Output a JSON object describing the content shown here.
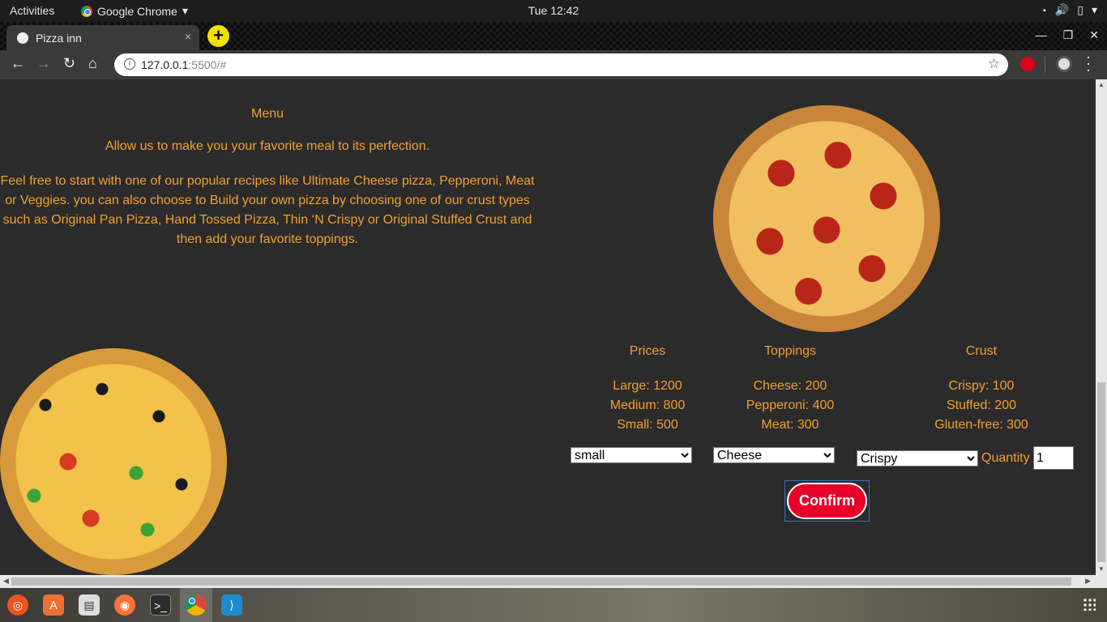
{
  "system": {
    "activities": "Activities",
    "app_name": "Google Chrome",
    "clock": "Tue 12:42"
  },
  "browser": {
    "tab_title": "Pizza inn",
    "tab_close": "×",
    "new_tab": "+",
    "url_host": "127.0.0.1",
    "url_rest": ":5500/#"
  },
  "page": {
    "menu_title": "Menu",
    "intro": "Allow us to make you your favorite meal to its perfection.",
    "description": "Feel free to start with one of our popular recipes like Ultimate Cheese pizza, Pepperoni, Meat or Veggies. you can also choose to Build your own pizza by choosing one of our crust types such as Original Pan Pizza, Hand Tossed Pizza, Thin ‘N Crispy or Original Stuffed Crust and then add your favorite toppings.",
    "prices": {
      "title": "Prices",
      "items": [
        "Large: 1200",
        "Medium: 800",
        "Small: 500"
      ]
    },
    "toppings": {
      "title": "Toppings",
      "items": [
        "Cheese: 200",
        "Pepperoni: 400",
        "Meat: 300"
      ]
    },
    "crust": {
      "title": "Crust",
      "items": [
        "Crispy: 100",
        "Stuffed: 200",
        "Gluten-free: 300"
      ]
    },
    "size_select": "small",
    "topping_select": "Cheese",
    "crust_select": "Crispy",
    "quantity_label": "Quantity",
    "quantity_value": "1",
    "confirm_label": "Confirm"
  },
  "colors": {
    "accent_text": "#f0a030",
    "confirm_bg": "#e8002a",
    "page_bg": "#2b2b2b"
  }
}
